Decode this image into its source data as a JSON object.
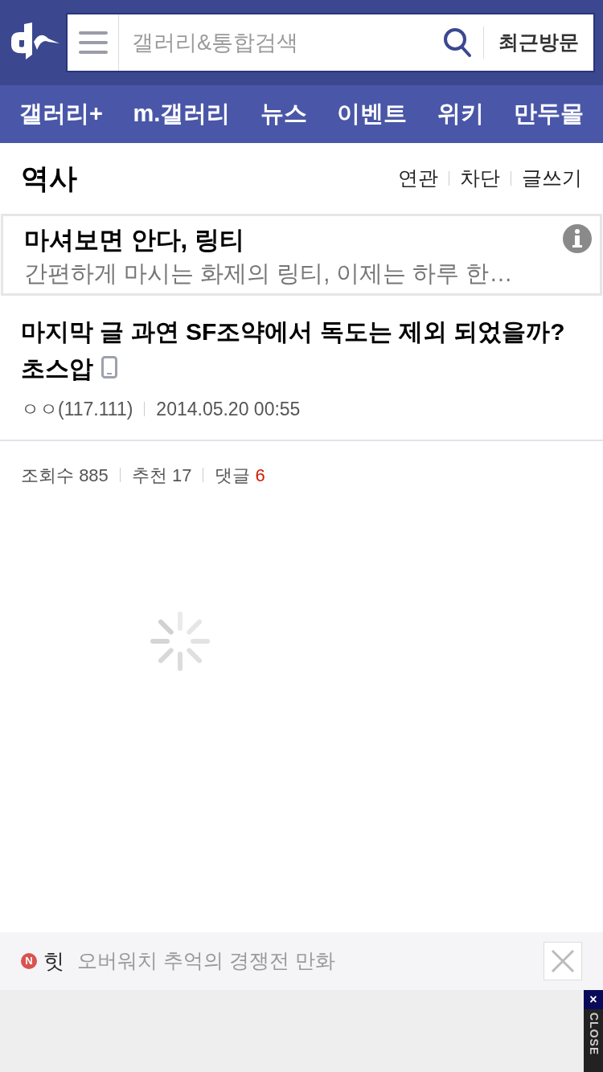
{
  "header": {
    "search": {
      "placeholder": "갤러리&통합검색"
    },
    "recent_button": "최근방문"
  },
  "nav": [
    "갤러리+",
    "m.갤러리",
    "뉴스",
    "이벤트",
    "위키",
    "만두몰"
  ],
  "gallery": {
    "title": "역사",
    "actions": [
      "연관",
      "차단",
      "글쓰기"
    ]
  },
  "ad": {
    "title": "마셔보면 안다, 링티",
    "text": "간편하게 마시는 화제의 링티, 이제는 하루 한…"
  },
  "post": {
    "title": "마지막 글 과연 SF조약에서 독도는 제외 되었을까? 초스압",
    "author": "ㅇㅇ(117.111)",
    "date": "2014.05.20 00:55",
    "stats": [
      {
        "label": "조회수",
        "value": "885",
        "kind": "plain"
      },
      {
        "label": "추천",
        "value": "17",
        "kind": "plain"
      },
      {
        "label": "댓글",
        "value": "6",
        "kind": "highlight"
      }
    ]
  },
  "loading": true,
  "bottom_banner": {
    "badge": "N",
    "label": "힛",
    "text": "오버워치 추억의 경쟁전 만화"
  },
  "close_tab": {
    "mark": "×",
    "label": "CLOSE"
  }
}
